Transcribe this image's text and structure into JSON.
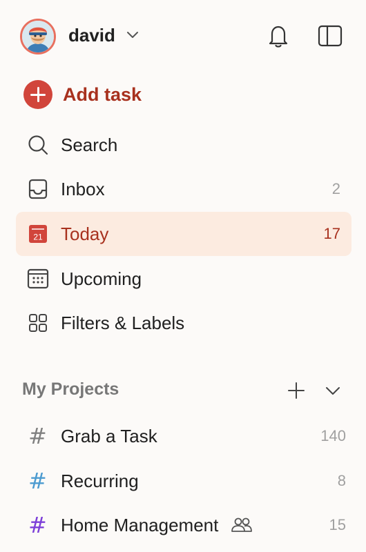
{
  "user": {
    "name": "david"
  },
  "add_task": {
    "label": "Add task"
  },
  "nav": [
    {
      "label": "Search",
      "count": ""
    },
    {
      "label": "Inbox",
      "count": "2"
    },
    {
      "label": "Today",
      "count": "17",
      "date_badge": "21"
    },
    {
      "label": "Upcoming",
      "count": ""
    },
    {
      "label": "Filters & Labels",
      "count": ""
    }
  ],
  "projects_section": {
    "title": "My Projects"
  },
  "projects": [
    {
      "label": "Grab a Task",
      "count": "140",
      "color": "#808080",
      "symbol": "#"
    },
    {
      "label": "Recurring",
      "count": "8",
      "color": "#4c9bd0",
      "symbol": "#"
    },
    {
      "label": "Home Management",
      "count": "15",
      "color": "#7c3fd8",
      "symbol": "#",
      "shared": true
    }
  ],
  "colors": {
    "accent": "#d1453b",
    "accent_text": "#a8311e",
    "active_bg": "#fcebe0",
    "background": "#fcfaf8"
  }
}
